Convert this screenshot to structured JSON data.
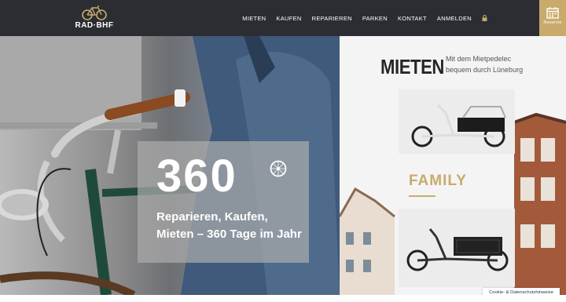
{
  "logo": {
    "text": "RAD·BHF"
  },
  "nav": {
    "items": [
      "MIETEN",
      "KAUFEN",
      "REPARIEREN",
      "PARKEN",
      "KONTAKT",
      "ANMELDEN"
    ],
    "reserve_label": "Reservie"
  },
  "hero": {
    "big_number": "360",
    "tagline_line1": "Reparieren, Kaufen,",
    "tagline_line2": "Mieten – 360 Tage im Jahr"
  },
  "rent": {
    "title": "MIETEN",
    "subtitle_line1": "Mit dem Mietpedelec",
    "subtitle_line2": "bequem durch Lüneburg",
    "card_family_label": "FAMILY"
  },
  "cookie": {
    "label": "Cookie- & Datenschutzhinweise"
  },
  "colors": {
    "accent": "#c8ab6a",
    "nav_bg": "#2b2d33"
  }
}
